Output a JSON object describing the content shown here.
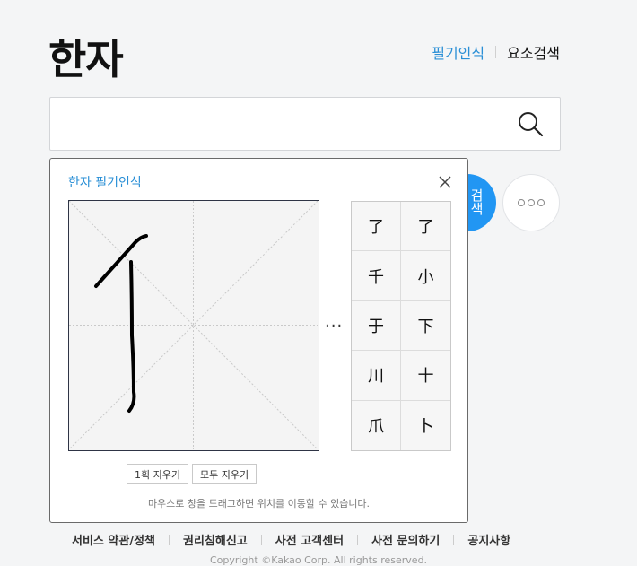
{
  "header": {
    "title": "한자",
    "links": [
      "필기인식",
      "요소검색"
    ]
  },
  "search": {
    "value": "",
    "placeholder": ""
  },
  "side_buttons": {
    "blue_label": "검색"
  },
  "handwriting": {
    "title": "한자 필기인식",
    "more_label": "···",
    "candidates": [
      "了",
      "了",
      "千",
      "小",
      "于",
      "下",
      "川",
      "十",
      "爪",
      "卜"
    ],
    "buttons": {
      "undo_stroke": "1획 지우기",
      "clear_all": "모두 지우기"
    },
    "hint": "마우스로 창을 드래그하면 위치를 이동할 수 있습니다."
  },
  "footer": {
    "links": [
      "서비스 약관/정책",
      "권리침해신고",
      "사전 고객센터",
      "사전 문의하기",
      "공지사항"
    ],
    "copyright": "Copyright ©Kakao Corp. All rights reserved."
  },
  "colors": {
    "accent": "#2a8fd6",
    "blue_button": "#2196f3",
    "background": "#f4f5f6"
  }
}
